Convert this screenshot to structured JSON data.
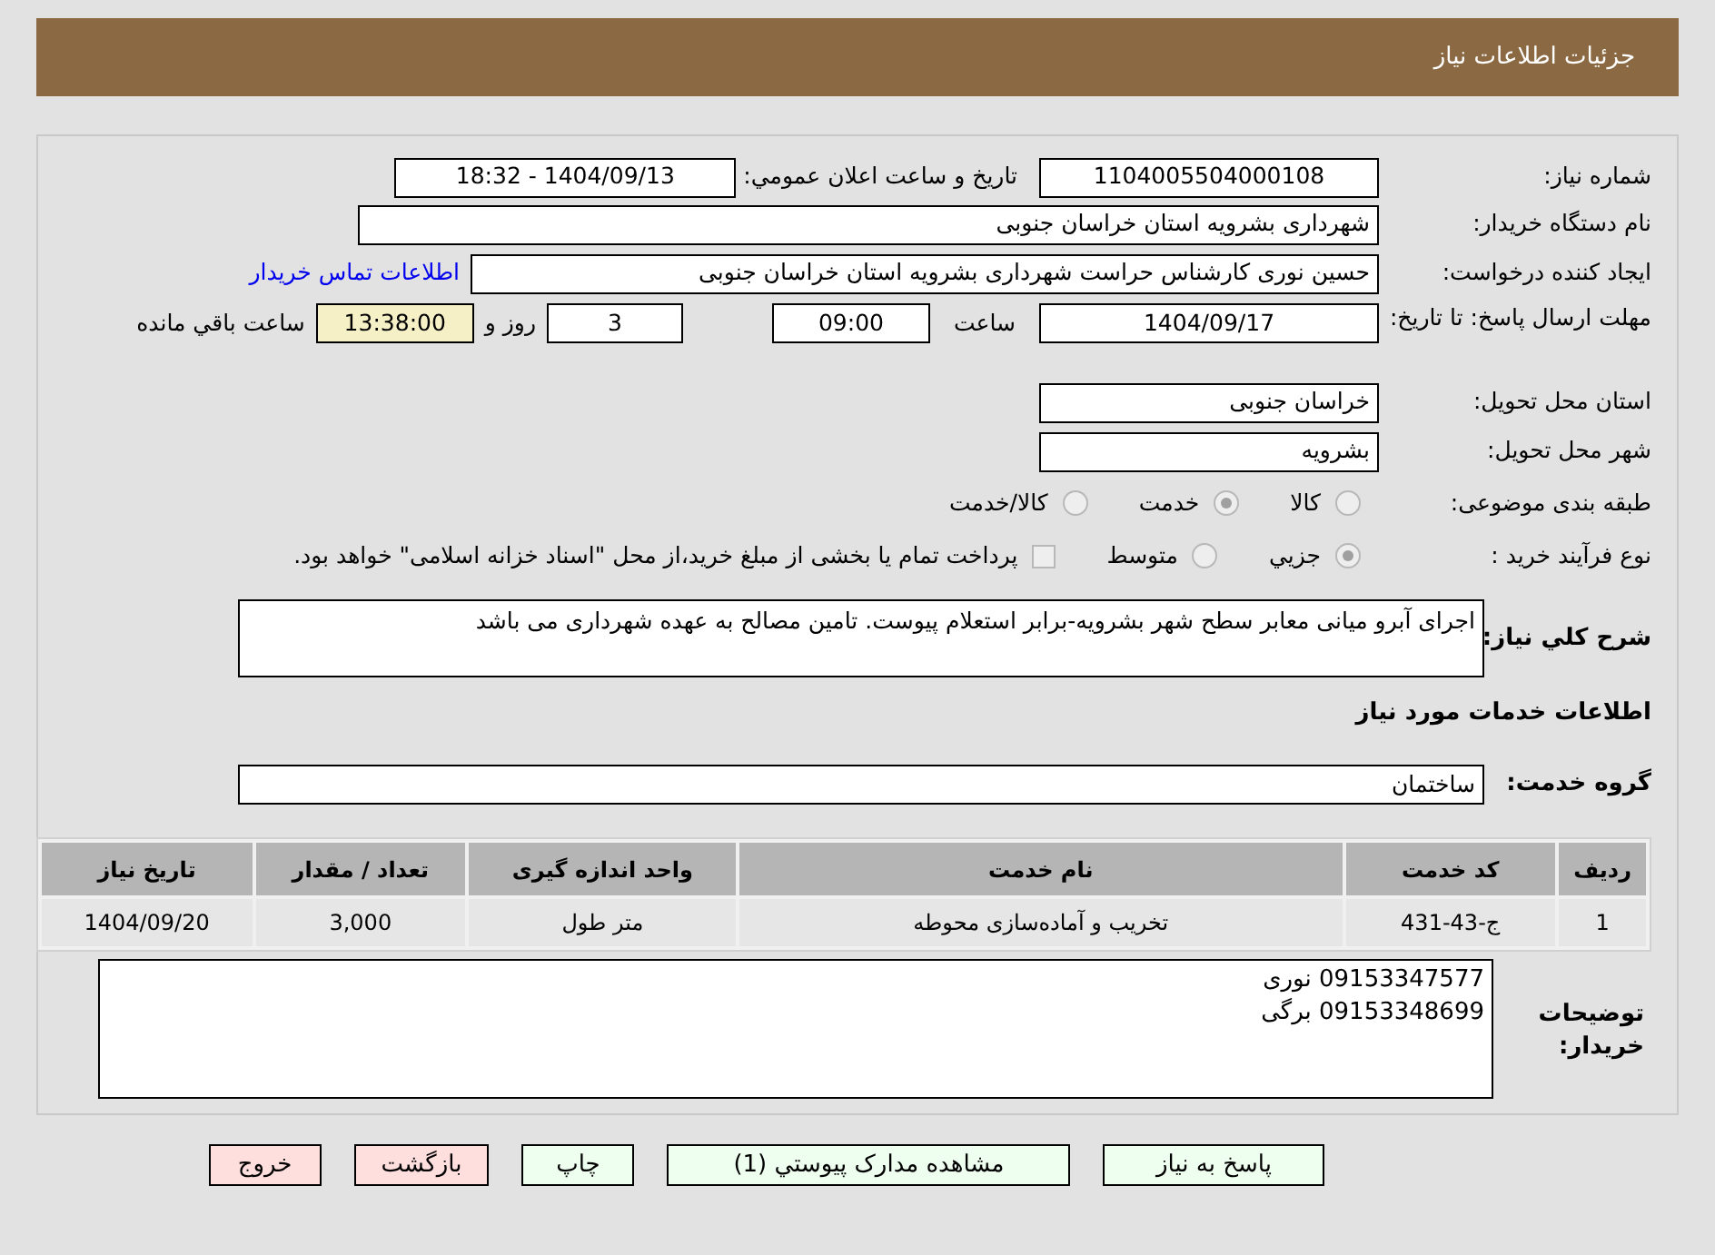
{
  "header": {
    "title": "جزئیات اطلاعات نیاز"
  },
  "need_number": {
    "label": "شماره نياز:",
    "value": "1104005504000108"
  },
  "announce_date": {
    "label": "تاريخ و ساعت اعلان عمومي:",
    "value": "1404/09/13 - 18:32"
  },
  "buyer_org": {
    "label": "نام دستگاه خريدار:",
    "value": "شهرداری بشرویه استان خراسان جنوبی"
  },
  "creator": {
    "label": "ايجاد کننده درخواست:",
    "value": "حسین نوری کارشناس حراست شهرداری بشرویه استان خراسان جنوبی",
    "link": "اطلاعات تماس خريدار"
  },
  "deadline": {
    "label": "مهلت ارسال پاسخ: تا تاریخ:",
    "date": "1404/09/17",
    "time_label": "ساعت",
    "time": "09:00",
    "days": "3",
    "days_label": "روز و",
    "remaining": "13:38:00",
    "remaining_label": "ساعت باقي مانده"
  },
  "province": {
    "label": "استان محل تحویل:",
    "value": "خراسان جنوبی"
  },
  "city": {
    "label": "شهر محل تحویل:",
    "value": "بشرویه"
  },
  "category": {
    "label": "طبقه بندی موضوعی:",
    "options": [
      {
        "label": "کالا",
        "selected": false
      },
      {
        "label": "خدمت",
        "selected": true
      },
      {
        "label": "کالا/خدمت",
        "selected": false
      }
    ]
  },
  "purchase_type": {
    "label": "نوع فرآیند خرید :",
    "options": [
      {
        "label": "جزيي",
        "selected": true
      },
      {
        "label": "متوسط",
        "selected": false
      }
    ],
    "payment_note": {
      "label": "پرداخت تمام یا بخشی از مبلغ خرید،از محل \"اسناد خزانه اسلامی\" خواهد بود.",
      "checked": false
    }
  },
  "description": {
    "label": "شرح کلي نياز:",
    "value": "اجرای آبرو میانی معابر سطح شهر بشرویه-برابر استعلام پیوست. تامین مصالح به عهده شهرداری می باشد"
  },
  "services_title": "اطلاعات خدمات مورد نياز",
  "service_group": {
    "label": "گروه خدمت:",
    "value": "ساختمان"
  },
  "table": {
    "columns": [
      "رديف",
      "کد خدمت",
      "نام خدمت",
      "واحد اندازه گيری",
      "تعداد / مقدار",
      "تاريخ نياز"
    ],
    "rows": [
      [
        "1",
        "ج-43-431",
        "تخریب و آماده‌سازی محوطه",
        "متر طول",
        "3,000",
        "1404/09/20"
      ]
    ]
  },
  "buyer_notes": {
    "label": "توضيحات خريدار:",
    "lines": [
      "09153347577 نوری",
      "09153348699 برگی"
    ]
  },
  "buttons": [
    {
      "label": "پاسخ به نياز",
      "kind": "primary"
    },
    {
      "label": "مشاهده مدارک پيوستي (1)",
      "kind": "primary"
    },
    {
      "label": "چاپ",
      "kind": "primary"
    },
    {
      "label": "بازگشت",
      "kind": "danger"
    },
    {
      "label": "خروج",
      "kind": "danger"
    }
  ]
}
